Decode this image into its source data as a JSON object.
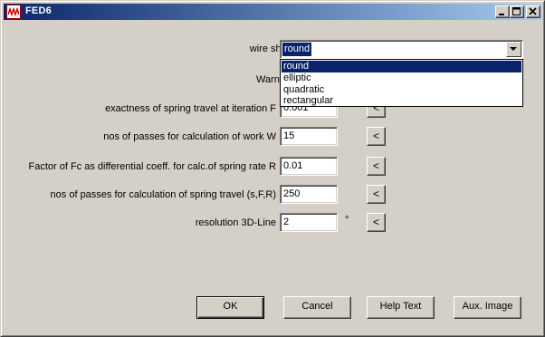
{
  "window": {
    "title": "FED6"
  },
  "titlebar": {
    "icon": "app-icon",
    "buttons": [
      "minimize-icon",
      "maximize-icon",
      "close-icon"
    ]
  },
  "form": {
    "wire_shape_label": "wire shape",
    "wire_shape_value": "round",
    "wire_shape_options": [
      "round",
      "elliptic",
      "quadratic",
      "rectangular"
    ],
    "warnings_label": "Warnings",
    "exactness_label": "exactness of spring travel at iteration F",
    "exactness_value": "0.001",
    "passes_work_label": "nos of passes for calculation of work W",
    "passes_work_value": "15",
    "factor_fc_label": "Factor of Fc as differential coeff. for calc.of spring rate R",
    "factor_fc_value": "0.01",
    "passes_travel_label": "nos of passes for calculation of spring travel (s,F,R)",
    "passes_travel_value": "250",
    "resolution_label": "resolution 3D-Line",
    "resolution_value": "2",
    "resolution_unit": "°",
    "small_button_label": "<"
  },
  "buttons": {
    "ok": "OK",
    "cancel": "Cancel",
    "help": "Help Text",
    "aux": "Aux. Image"
  },
  "colors": {
    "titlebar_start": "#0a246a",
    "titlebar_end": "#a6caf0",
    "face": "#d4d0c8",
    "selection": "#0a246a"
  }
}
